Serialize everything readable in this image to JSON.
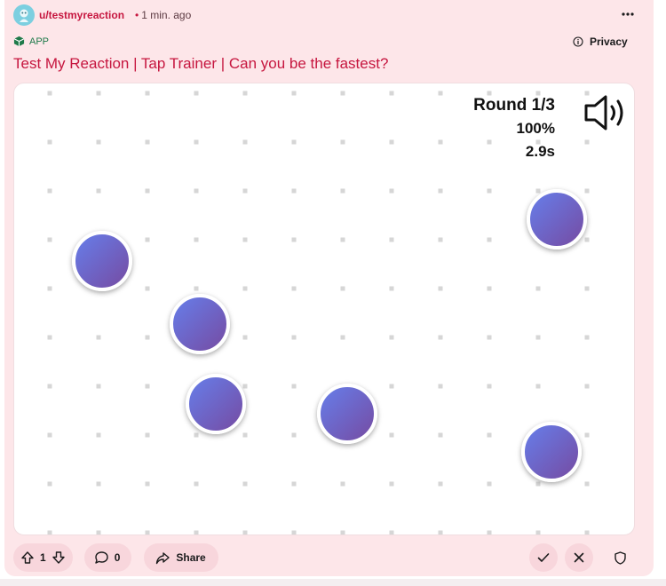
{
  "post": {
    "author": "u/testmyreaction",
    "separator": "•",
    "time": "1 min. ago",
    "app_label": "APP",
    "privacy_label": "Privacy",
    "title": "Test My Reaction | Tap Trainer | Can you be the fastest?"
  },
  "game": {
    "round": "Round 1/3",
    "accuracy": "100%",
    "time": "2.9s",
    "target_count": 6
  },
  "actions": {
    "upvotes": "1",
    "comments": "0",
    "share_label": "Share"
  },
  "icons": [
    "avatar-icon",
    "more-icon",
    "app-icon",
    "info-icon",
    "speaker-icon",
    "upvote-icon",
    "downvote-icon",
    "comment-icon",
    "share-icon",
    "check-icon",
    "close-icon",
    "shield-icon"
  ],
  "colors": {
    "post_bg": "#fde6e9",
    "accent": "#c6163f",
    "button_bg": "#f8d6dc",
    "target_gradient_start": "#667eea",
    "target_gradient_end": "#764ba2"
  }
}
